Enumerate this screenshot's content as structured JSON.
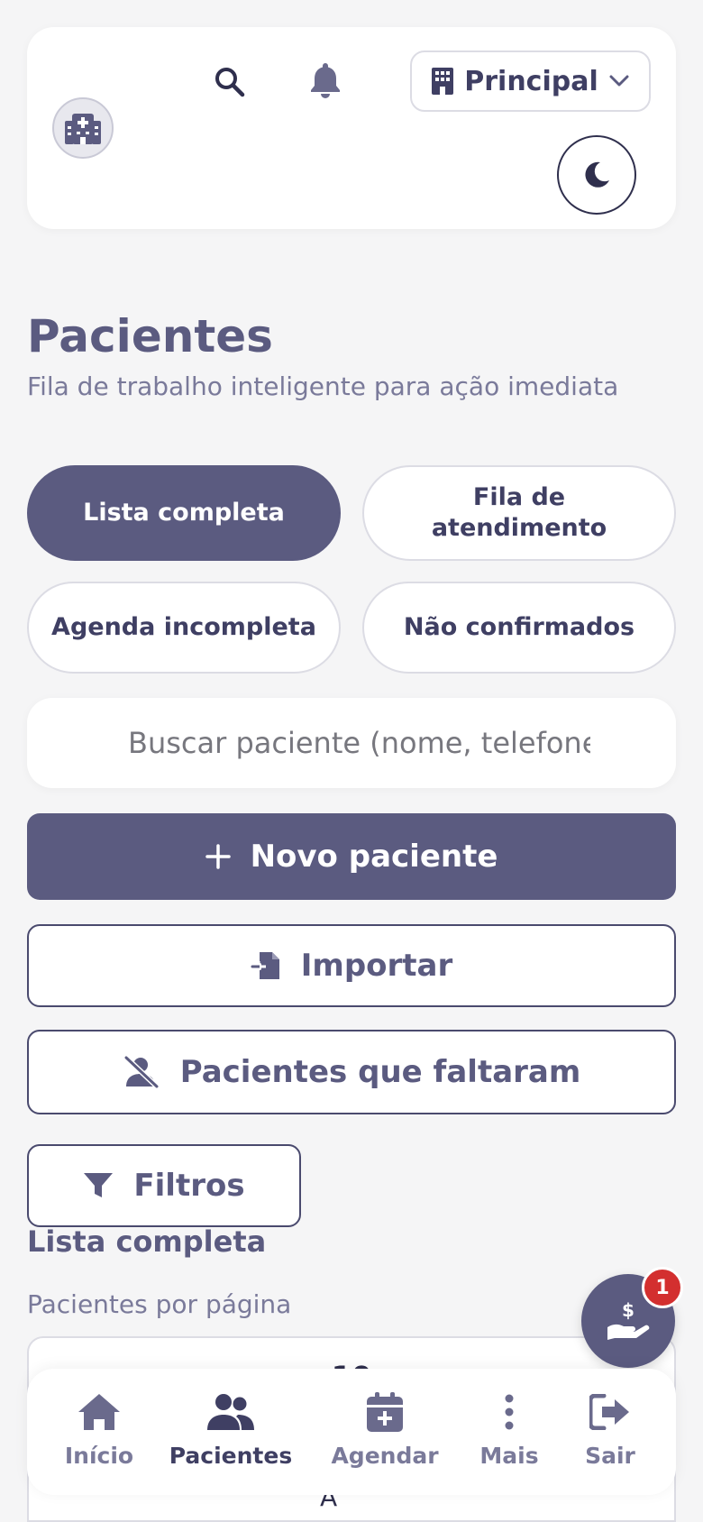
{
  "header": {
    "unit_label": "Principal"
  },
  "page": {
    "title": "Pacientes",
    "subtitle": "Fila de trabalho inteligente para ação imediata"
  },
  "tabs": [
    {
      "label": "Lista completa",
      "active": true
    },
    {
      "label": "Fila de atendimento",
      "active": false
    },
    {
      "label": "Agenda incompleta",
      "active": false
    },
    {
      "label": "Não confirmados",
      "active": false
    }
  ],
  "search": {
    "placeholder": "Buscar paciente (nome, telefone"
  },
  "actions": {
    "new_patient": "Novo paciente",
    "import": "Importar",
    "absent_patients": "Pacientes que faltaram",
    "filters": "Filtros"
  },
  "list": {
    "section_title": "Lista completa",
    "per_page_label": "Pacientes por página",
    "per_page_value": "10",
    "sort_letter": "A"
  },
  "fab": {
    "badge_count": "1"
  },
  "bottom_nav": [
    {
      "label": "Início",
      "icon": "home-icon",
      "active": false
    },
    {
      "label": "Pacientes",
      "icon": "users-icon",
      "active": true
    },
    {
      "label": "Agendar",
      "icon": "calendar-plus-icon",
      "active": false
    },
    {
      "label": "Mais",
      "icon": "more-vertical-icon",
      "active": false
    },
    {
      "label": "Sair",
      "icon": "logout-icon",
      "active": false
    }
  ],
  "colors": {
    "primary": "#5b5b80",
    "background": "#f5f5f6",
    "badge": "#d32f2f"
  }
}
